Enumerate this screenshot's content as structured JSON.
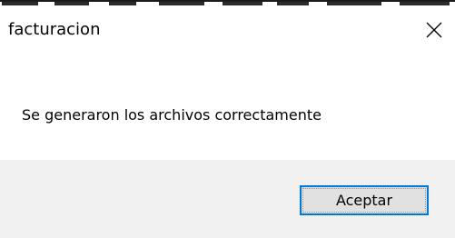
{
  "dialog": {
    "title": "facturacion",
    "close_icon": "close-icon",
    "message": "Se generaron los archivos correctamente",
    "ok_label": "Aceptar"
  },
  "colors": {
    "button_border": "#0078d7",
    "button_bg": "#e1e1e1",
    "footer_bg": "#f0f0f0",
    "window_bg": "#ffffff"
  }
}
